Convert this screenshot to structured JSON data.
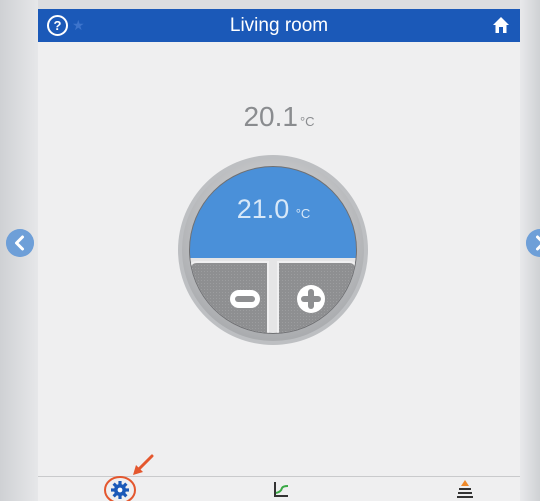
{
  "header": {
    "title": "Living room",
    "help_glyph": "?",
    "background_color": "#1b59b8"
  },
  "current_temperature": {
    "value": "20.1",
    "unit": "°C"
  },
  "setpoint": {
    "value": "21.0",
    "unit": "°C",
    "decrease_glyph": "−",
    "increase_glyph": "+",
    "accent_color": "#4a90d9"
  },
  "navigation": {
    "previous_icon": "chevron-left-icon",
    "next_icon": "chevron-right-icon"
  },
  "bottom_bar": {
    "items": [
      {
        "name": "settings",
        "icon": "gear-icon",
        "highlighted": true,
        "highlight_color": "#e4572e"
      },
      {
        "name": "chart",
        "icon": "chart-icon"
      },
      {
        "name": "layers",
        "icon": "layers-icon"
      }
    ]
  }
}
